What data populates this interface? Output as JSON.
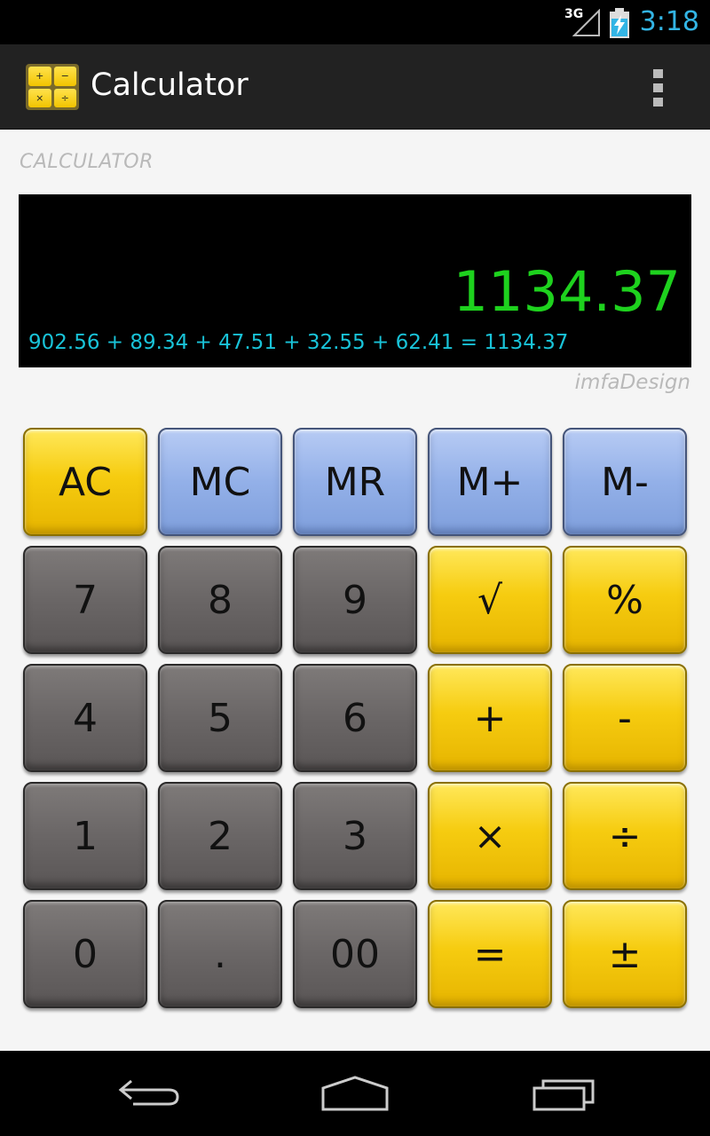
{
  "statusbar": {
    "network": "3G",
    "time": "3:18"
  },
  "actionbar": {
    "title": "Calculator",
    "icon_symbols": [
      "+",
      "−",
      "×",
      "÷"
    ]
  },
  "section_label": "CALCULATOR",
  "display": {
    "value": "1134.37",
    "expression": "902.56 + 89.34 + 47.51 + 32.55 + 62.41 = 1134.37"
  },
  "brand": "imfaDesign",
  "keys": {
    "ac": "AC",
    "mc": "MC",
    "mr": "MR",
    "mplus": "M+",
    "mminus": "M-",
    "seven": "7",
    "eight": "8",
    "nine": "9",
    "sqrt": "√",
    "percent": "%",
    "four": "4",
    "five": "5",
    "six": "6",
    "plus": "+",
    "minus": "-",
    "one": "1",
    "two": "2",
    "three": "3",
    "multiply": "×",
    "divide": "÷",
    "zero": "0",
    "dot": ".",
    "double_zero": "00",
    "equals": "=",
    "plusminus": "±"
  },
  "colors": {
    "display_value": "#1ed21e",
    "display_expression": "#19c3d8",
    "status_time": "#33b5e5",
    "key_yellow": "#f6cc10",
    "key_blue": "#93b0e8",
    "key_gray": "#6a6666"
  },
  "icons": {
    "signal": "signal-icon",
    "battery": "battery-charging-icon",
    "overflow": "overflow-menu-icon",
    "back": "back-icon",
    "home": "home-icon",
    "recents": "recents-icon"
  }
}
